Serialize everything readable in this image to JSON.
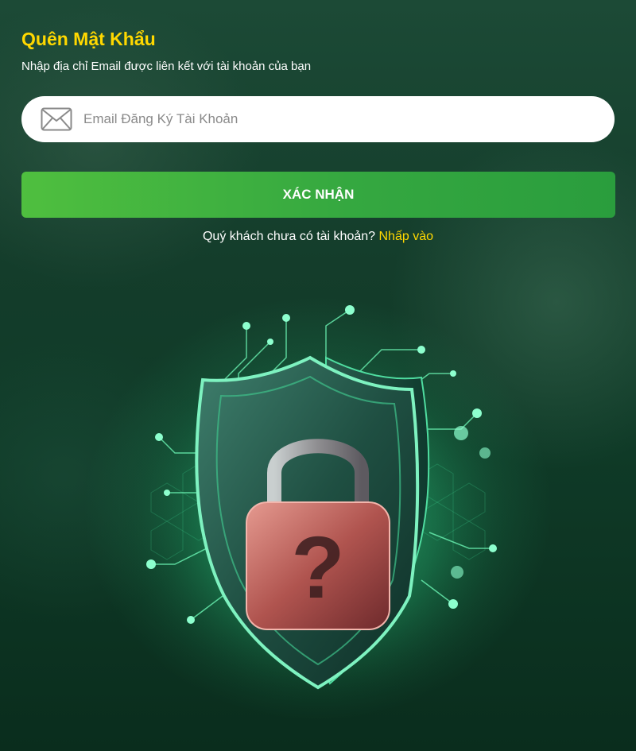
{
  "form": {
    "title": "Quên Mật Khẩu",
    "subtitle": "Nhập địa chỉ Email được liên kết với tài khoản của bạn",
    "email_placeholder": "Email Đăng Ký Tài Khoản",
    "email_value": "",
    "submit_label": "XÁC NHẬN",
    "signup_prompt": "Quý khách chưa có tài khoản?",
    "signup_link": "Nhấp vào"
  },
  "icons": {
    "email": "envelope-icon",
    "hero": "shield-lock-question-icon"
  },
  "colors": {
    "title": "#ffd800",
    "link": "#ffd800",
    "button": "#3cb043",
    "background": "#143d2b"
  }
}
